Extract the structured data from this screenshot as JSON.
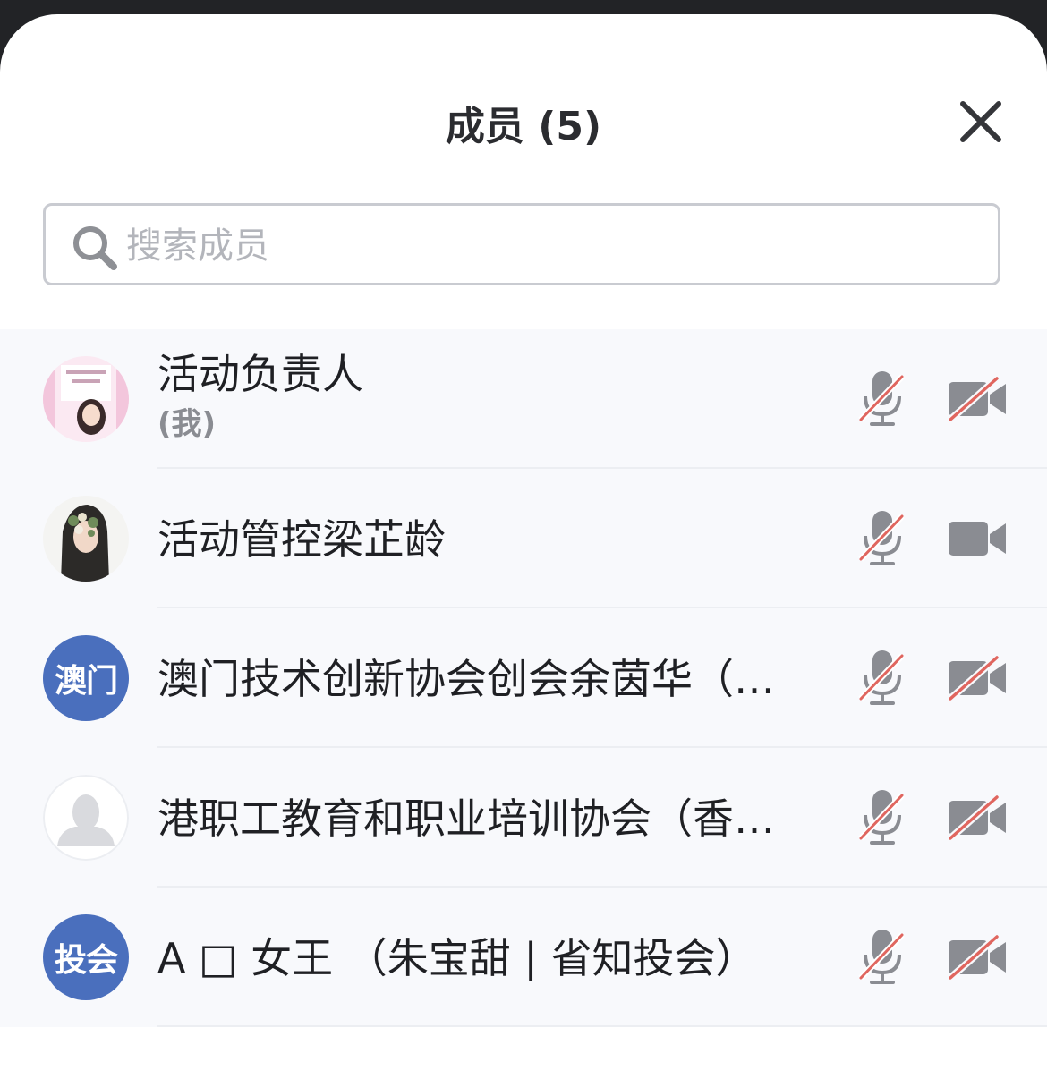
{
  "header": {
    "title": "成员 (5)"
  },
  "search": {
    "placeholder": "搜索成员",
    "value": ""
  },
  "members": [
    {
      "name": "活动负责人",
      "tag": "(我)",
      "avatar": "photo",
      "mic": "muted",
      "camera": "off"
    },
    {
      "name": "活动管控梁芷龄",
      "avatar": "photo",
      "mic": "muted",
      "camera": "on"
    },
    {
      "name": "澳门技术创新协会创会余茵华（…",
      "avatar_text": "澳门",
      "mic": "muted",
      "camera": "off"
    },
    {
      "name": "港职工教育和职业培训协会（香…",
      "avatar": "default-person",
      "mic": "muted",
      "camera": "off"
    },
    {
      "name": "A □  女王 （朱宝甜 | 省知投会）",
      "avatar_text": "投会",
      "mic": "muted",
      "camera": "off"
    }
  ],
  "colors": {
    "accent_avatar": "#4a6fbd",
    "muted_slash": "#e0665f",
    "icon_gray": "#8a8c92"
  }
}
